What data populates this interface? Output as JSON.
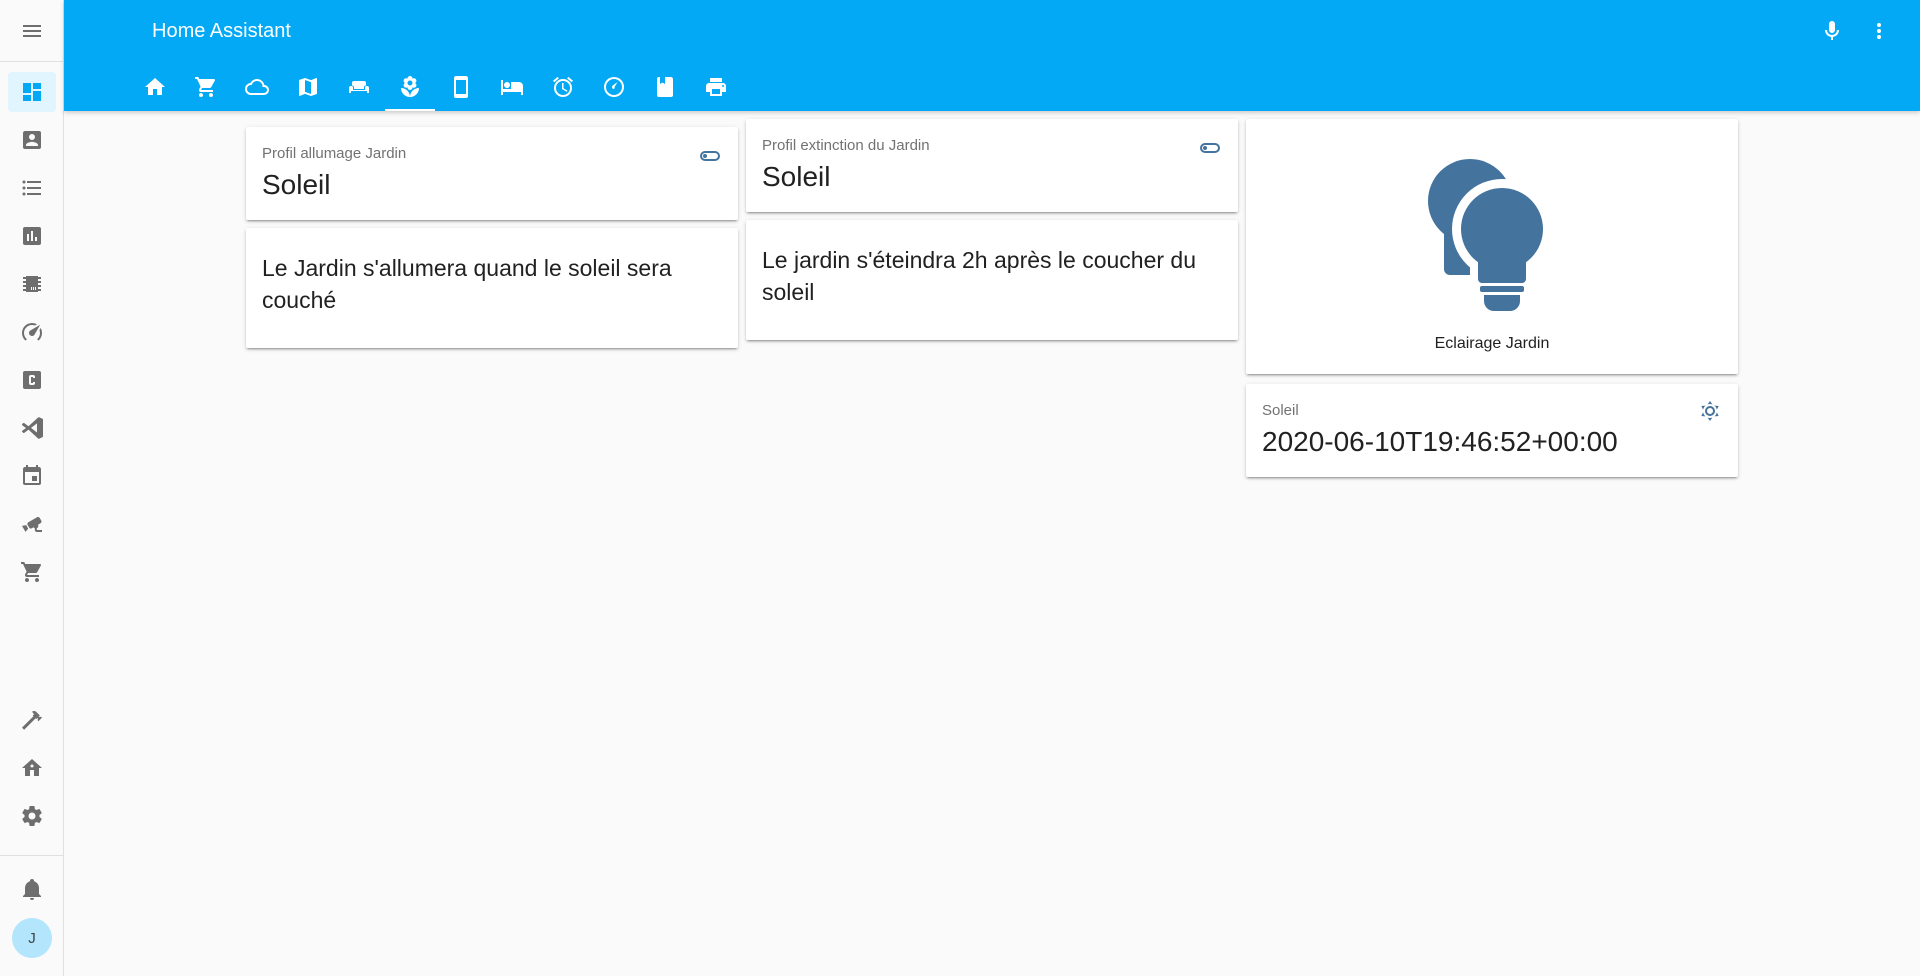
{
  "app": {
    "title": "Home Assistant"
  },
  "header": {
    "icons": [
      "microphone-icon",
      "dots-vertical-icon"
    ],
    "tabs": [
      "home-icon",
      "cart-icon",
      "cloud-icon",
      "map-icon",
      "sofa-icon",
      "flower-icon",
      "cellphone-icon",
      "bed-icon",
      "alarm-icon",
      "gauge-icon",
      "book-icon",
      "printer-icon"
    ],
    "active_tab": "flower-icon"
  },
  "sidebar": {
    "items": [
      "dashboard-icon",
      "account-box-icon",
      "format-list-icon",
      "chart-icon",
      "chip-icon",
      "speedometer-icon",
      "c-box-icon",
      "vscode-icon",
      "calendar-icon",
      "cctv-icon",
      "cart-icon"
    ],
    "bottom_items": [
      "hammer-icon",
      "home-network-icon",
      "cog-icon"
    ],
    "notifications_icon": "bell-icon",
    "avatar_initial": "J"
  },
  "cards": {
    "profil_allumage": {
      "name": "Profil allumage Jardin",
      "state": "Soleil",
      "icon": "toggle-icon"
    },
    "texte_allumage": {
      "text": "Le Jardin s'allumera quand le soleil sera couché"
    },
    "profil_extinction": {
      "name": "Profil extinction du Jardin",
      "state": "Soleil",
      "icon": "toggle-icon"
    },
    "texte_extinction": {
      "text": "Le jardin s'éteindra 2h après le coucher du soleil"
    },
    "eclairage": {
      "name": "Eclairage Jardin",
      "icon": "lightbulb-multiple-icon"
    },
    "soleil": {
      "name": "Soleil",
      "state": "2020-06-10T19:46:52+00:00",
      "icon": "sun-icon"
    }
  },
  "colors": {
    "primary": "#03a9f4",
    "icon_state": "#44739e",
    "background": "#fafafa"
  }
}
